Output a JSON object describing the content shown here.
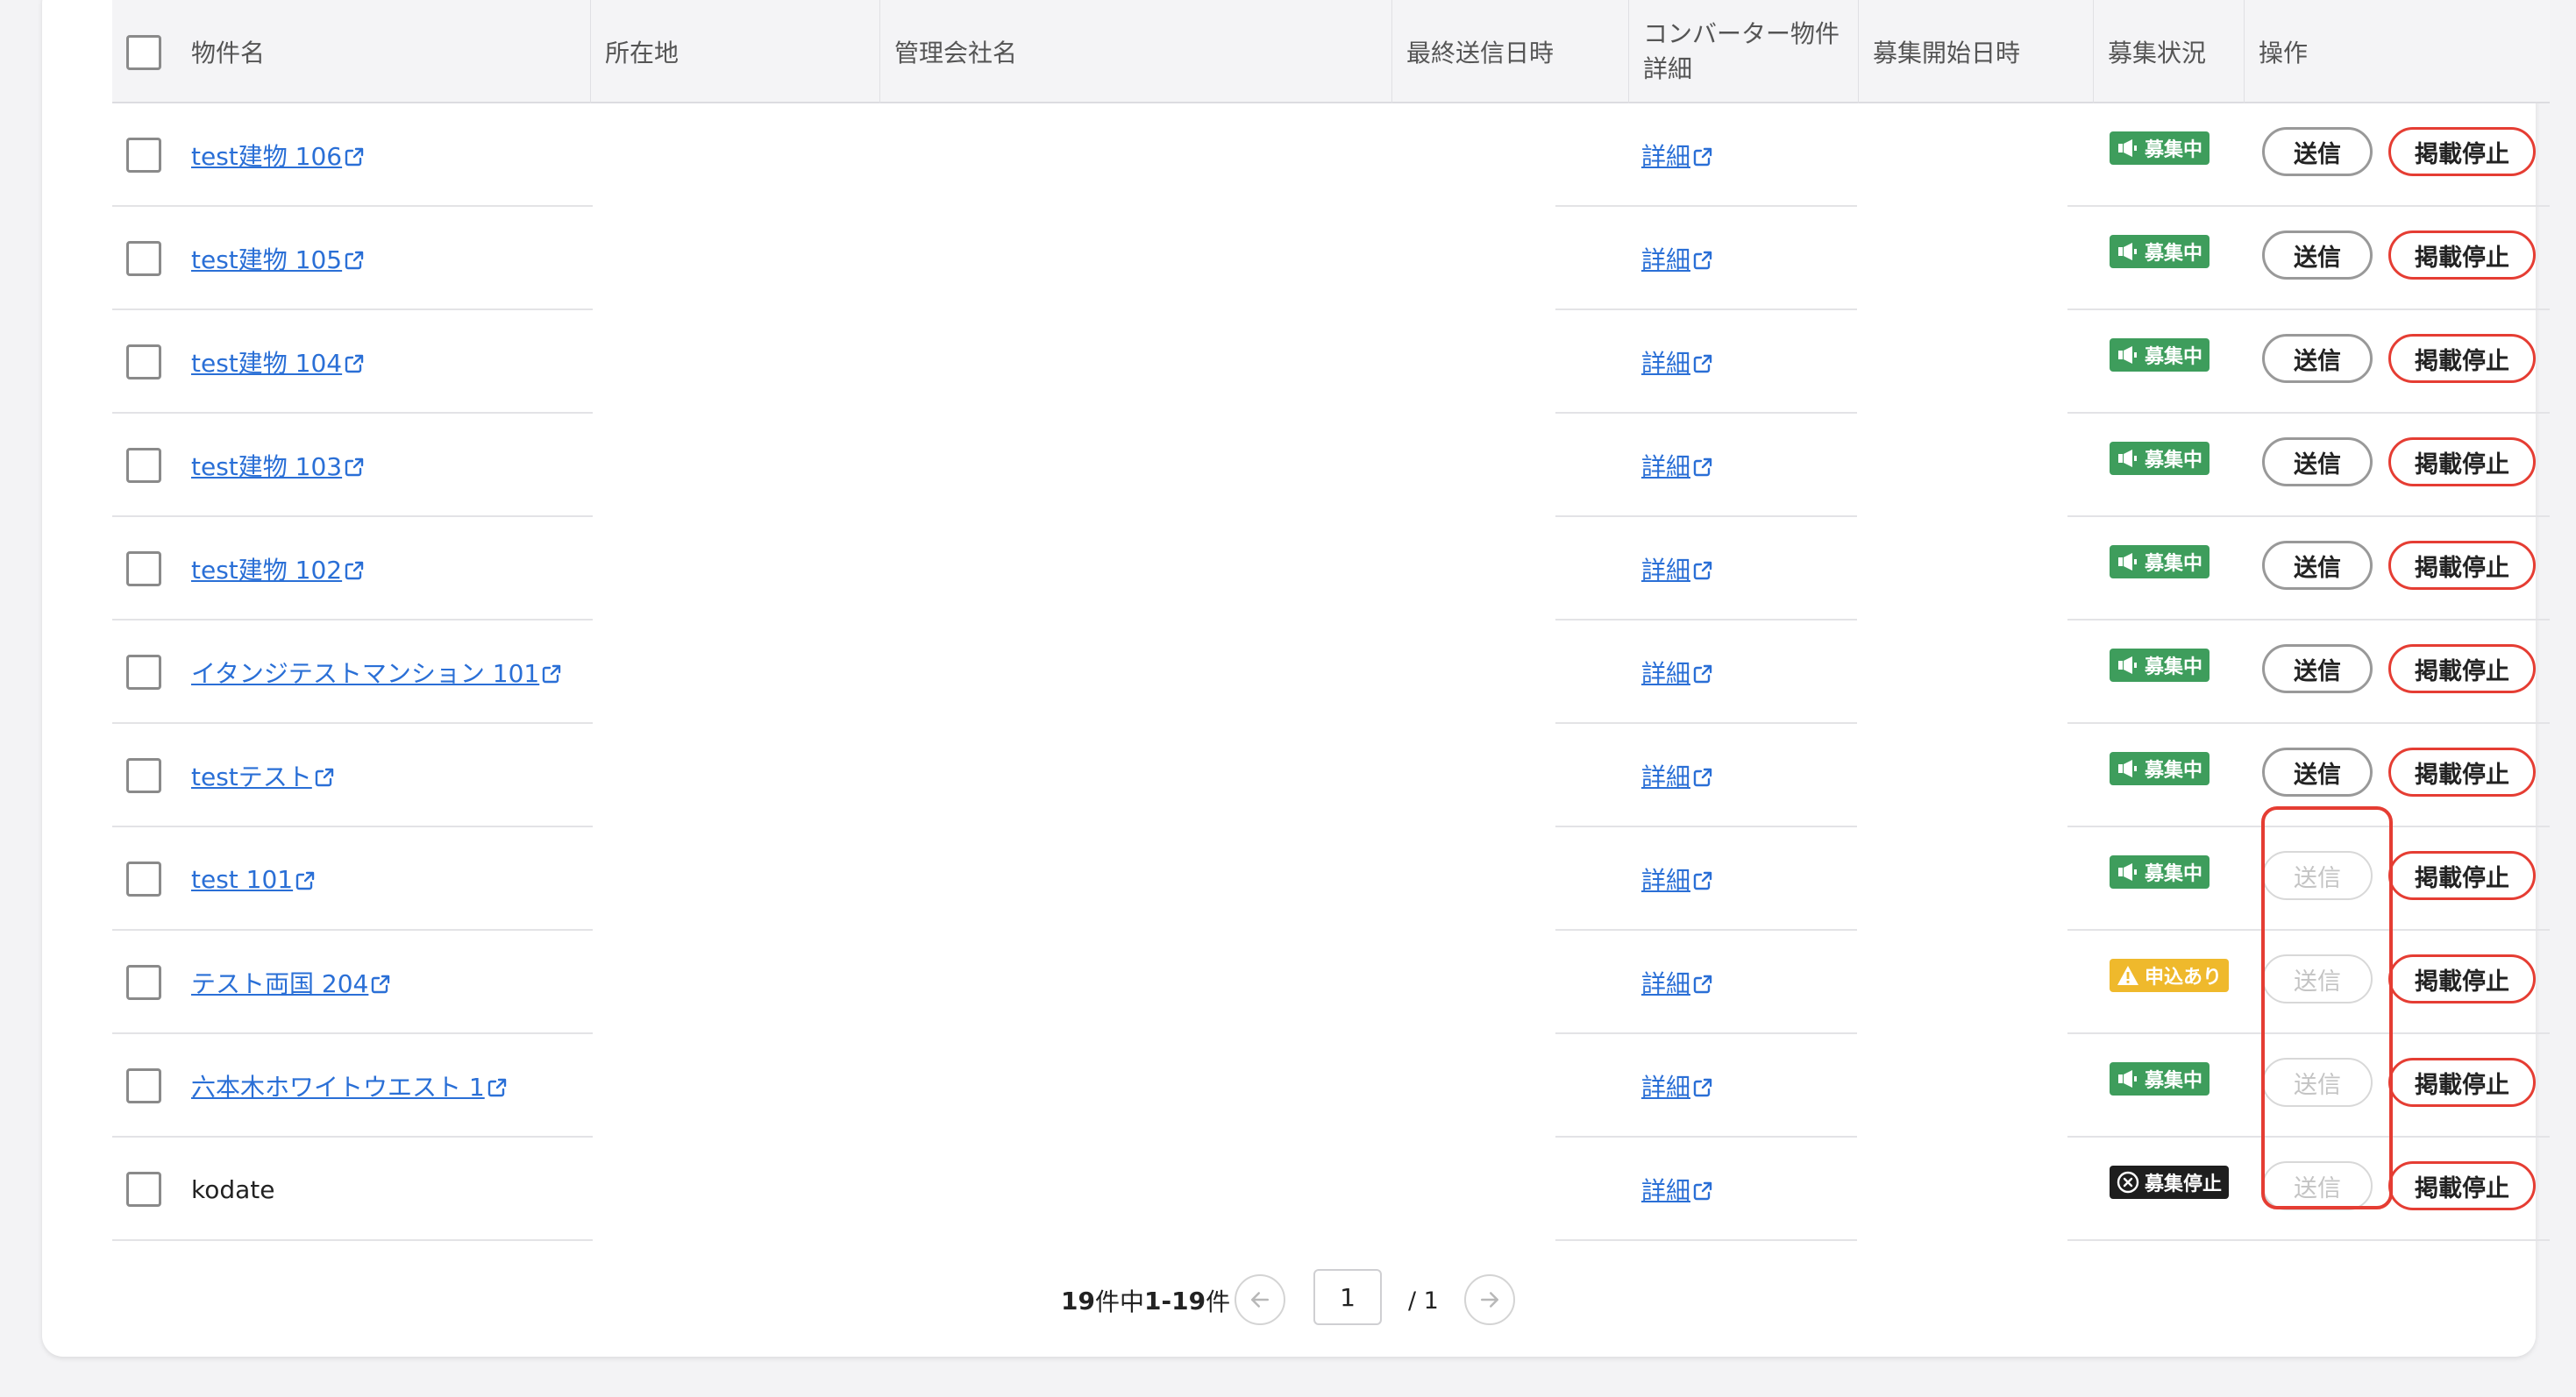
{
  "table": {
    "headers": {
      "name": "物件名",
      "location": "所在地",
      "company": "管理会社名",
      "last_sent": "最終送信日時",
      "converter_detail": "コンバーター物件\n詳細",
      "recruit_start": "募集開始日時",
      "recruit_status": "募集状況",
      "actions": "操作"
    },
    "rows": [
      {
        "name": "test建物 106",
        "link": true,
        "detail": "詳細",
        "status": "募集中",
        "status_type": "green",
        "send": "送信",
        "send_enabled": true,
        "stop": "掲載停止"
      },
      {
        "name": "test建物 105",
        "link": true,
        "detail": "詳細",
        "status": "募集中",
        "status_type": "green",
        "send": "送信",
        "send_enabled": true,
        "stop": "掲載停止"
      },
      {
        "name": "test建物 104",
        "link": true,
        "detail": "詳細",
        "status": "募集中",
        "status_type": "green",
        "send": "送信",
        "send_enabled": true,
        "stop": "掲載停止"
      },
      {
        "name": "test建物 103",
        "link": true,
        "detail": "詳細",
        "status": "募集中",
        "status_type": "green",
        "send": "送信",
        "send_enabled": true,
        "stop": "掲載停止"
      },
      {
        "name": "test建物 102",
        "link": true,
        "detail": "詳細",
        "status": "募集中",
        "status_type": "green",
        "send": "送信",
        "send_enabled": true,
        "stop": "掲載停止"
      },
      {
        "name": "イタンジテストマンション 101",
        "link": true,
        "detail": "詳細",
        "status": "募集中",
        "status_type": "green",
        "send": "送信",
        "send_enabled": true,
        "stop": "掲載停止"
      },
      {
        "name": "testテスト ",
        "link": true,
        "detail": "詳細",
        "status": "募集中",
        "status_type": "green",
        "send": "送信",
        "send_enabled": true,
        "stop": "掲載停止"
      },
      {
        "name": "test 101",
        "link": true,
        "detail": "詳細",
        "status": "募集中",
        "status_type": "green",
        "send": "送信",
        "send_enabled": false,
        "stop": "掲載停止"
      },
      {
        "name": "テスト両国 204",
        "link": true,
        "detail": "詳細",
        "status": "申込あり",
        "status_type": "yellow",
        "send": "送信",
        "send_enabled": false,
        "stop": "掲載停止"
      },
      {
        "name": "六本木ホワイトウエスト 1",
        "link": true,
        "detail": "詳細",
        "status": "募集中",
        "status_type": "green",
        "send": "送信",
        "send_enabled": false,
        "stop": "掲載停止"
      },
      {
        "name": "kodate",
        "link": false,
        "detail": "詳細",
        "status": "募集停止",
        "status_type": "black",
        "send": "送信",
        "send_enabled": false,
        "stop": "掲載停止"
      }
    ]
  },
  "pagination": {
    "total": "19",
    "total_suffix": "件中 ",
    "range": "1-19",
    "range_suffix": "件",
    "current_page": "1",
    "total_pages": "/ 1"
  },
  "colors": {
    "link": "#2a6fd6",
    "status_green": "#3e9d5c",
    "status_yellow": "#efb92c",
    "status_black": "#1e1e1e",
    "stop_border": "#e53d33",
    "highlight": "#e53d33"
  }
}
